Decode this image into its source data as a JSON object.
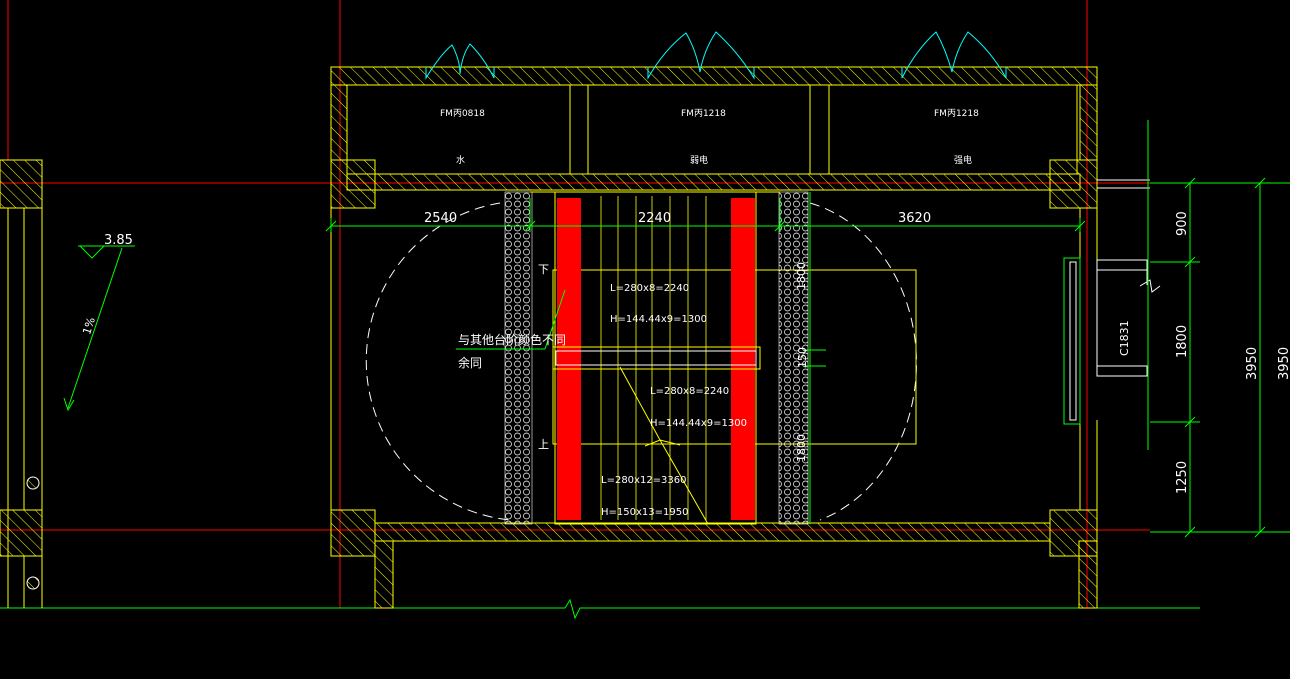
{
  "colors": {
    "background": "#000000",
    "axis_red": "#ff0000",
    "wall_yellow": "#ffff00",
    "dim_green": "#00ff00",
    "door_cyan": "#00ffff",
    "fill_red": "#ff0000",
    "text_white": "#ffffff"
  },
  "rooms": [
    {
      "door_code": "FM丙0818",
      "name": "水"
    },
    {
      "door_code": "FM丙1218",
      "name": "弱电"
    },
    {
      "door_code": "FM丙1218",
      "name": "强电"
    }
  ],
  "dimensions_top": [
    "2540",
    "2240",
    "3620"
  ],
  "dimensions_right": [
    "900",
    "1800",
    "1250",
    "3950",
    "3950"
  ],
  "dimensions_inner_vertical": [
    "1800",
    "150",
    "1800"
  ],
  "window_code": "C1831",
  "level_mark": "3.85",
  "slope_mark": "1%",
  "stair": {
    "flight_upper_L": "L=280x8=2240",
    "flight_upper_H": "H=144.44x9=1300",
    "flight_lower_L": "L=280x8=2240",
    "flight_lower_H": "H=144.44x9=1300",
    "first_L": "L=280x12=3360",
    "first_H": "H=150x13=1950",
    "down_label": "下",
    "up_label": "上"
  },
  "note_line1": "与其他台阶颜色不同",
  "note_line2": "余同"
}
